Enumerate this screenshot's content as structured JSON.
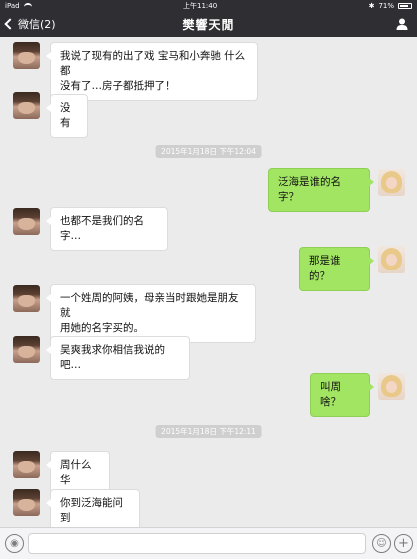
{
  "status_bar": {
    "device": "iPad",
    "time": "上午11:40",
    "battery": "71%"
  },
  "nav": {
    "back_label": "微信(2)",
    "title": "樊響天閒"
  },
  "timestamps": [
    "2015年1月18日 下午12:04",
    "2015年1月18日 下午12:11"
  ],
  "messages": [
    {
      "from": "other",
      "text": "我说了现有的出了戏 宝马和小奔驰 什么都\n没有了…房子都抵押了！"
    },
    {
      "from": "other",
      "text": "没有"
    },
    {
      "from": "me",
      "text": "泛海是谁的名字？"
    },
    {
      "from": "other",
      "text": "也都不是我们的名字…"
    },
    {
      "from": "me",
      "text": "那是谁的？"
    },
    {
      "from": "other",
      "text": "一个姓周的阿姨，母亲当时跟她是朋友就\n用她的名字买的。"
    },
    {
      "from": "other",
      "text": "吴爽我求你相信我说的吧…"
    },
    {
      "from": "me",
      "text": "叫周啥？"
    },
    {
      "from": "other",
      "text": "周什么华"
    },
    {
      "from": "other",
      "text": "你到泛海能问到"
    }
  ],
  "input": {
    "placeholder": ""
  }
}
